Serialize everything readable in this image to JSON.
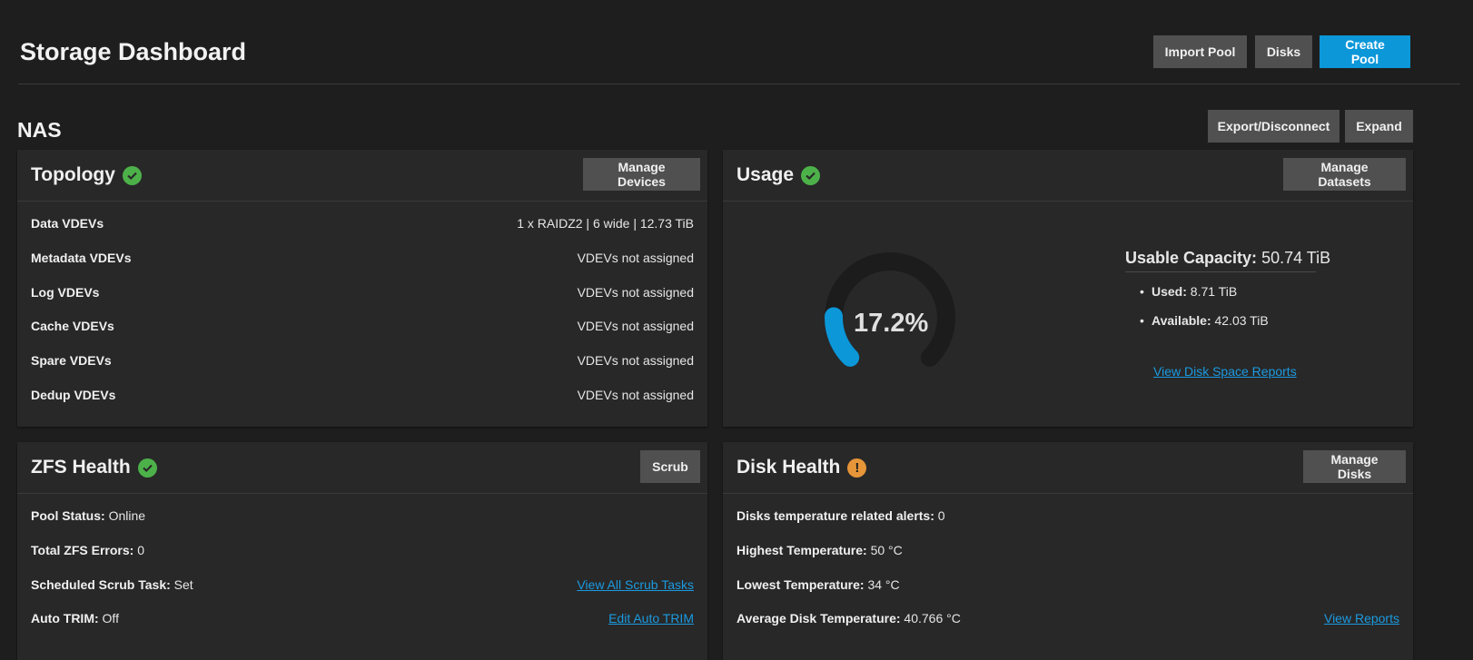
{
  "header": {
    "title": "Storage Dashboard",
    "import_pool": "Import Pool",
    "disks": "Disks",
    "create_pool": "Create Pool"
  },
  "pool": {
    "name": "NAS",
    "export_disconnect": "Export/Disconnect",
    "expand": "Expand"
  },
  "topology": {
    "title": "Topology",
    "status_icon": "check-circle-icon",
    "manage_button": "Manage Devices",
    "rows": [
      {
        "label": "Data VDEVs",
        "value": "1 x RAIDZ2 | 6 wide | 12.73 TiB"
      },
      {
        "label": "Metadata VDEVs",
        "value": "VDEVs not assigned"
      },
      {
        "label": "Log VDEVs",
        "value": "VDEVs not assigned"
      },
      {
        "label": "Cache VDEVs",
        "value": "VDEVs not assigned"
      },
      {
        "label": "Spare VDEVs",
        "value": "VDEVs not assigned"
      },
      {
        "label": "Dedup VDEVs",
        "value": "VDEVs not assigned"
      }
    ]
  },
  "usage": {
    "title": "Usage",
    "status_icon": "check-circle-icon",
    "manage_button": "Manage Datasets",
    "percent_label": "17.2%",
    "percent_value": 17.2,
    "capacity_label": "Usable Capacity:",
    "capacity_value": "50.74 TiB",
    "used_label": "Used:",
    "used_value": "8.71 TiB",
    "available_label": "Available:",
    "available_value": "42.03 TiB",
    "reports_link": "View Disk Space Reports"
  },
  "zfs_health": {
    "title": "ZFS Health",
    "status_icon": "check-circle-icon",
    "scrub_button": "Scrub",
    "pool_status_label": "Pool Status:",
    "pool_status_value": "Online",
    "errors_label": "Total ZFS Errors:",
    "errors_value": "0",
    "scrub_task_label": "Scheduled Scrub Task:",
    "scrub_task_value": "Set",
    "scrub_link": "View All Scrub Tasks",
    "trim_label": "Auto TRIM:",
    "trim_value": "Off",
    "trim_link": "Edit Auto TRIM"
  },
  "disk_health": {
    "title": "Disk Health",
    "status_icon": "warning-circle-icon",
    "warn_glyph": "!",
    "manage_button": "Manage Disks",
    "alerts_label": "Disks temperature related alerts:",
    "alerts_value": "0",
    "highest_label": "Highest Temperature:",
    "highest_value": "50 °C",
    "lowest_label": "Lowest Temperature:",
    "lowest_value": "34 °C",
    "average_label": "Average Disk Temperature:",
    "average_value": "40.766 °C",
    "reports_link": "View Reports"
  },
  "colors": {
    "background": "#1e1e1e",
    "card": "#282828",
    "primary": "#0c97d9",
    "success": "#4db14a",
    "warning": "#e69538",
    "link": "#1b9ae0"
  }
}
